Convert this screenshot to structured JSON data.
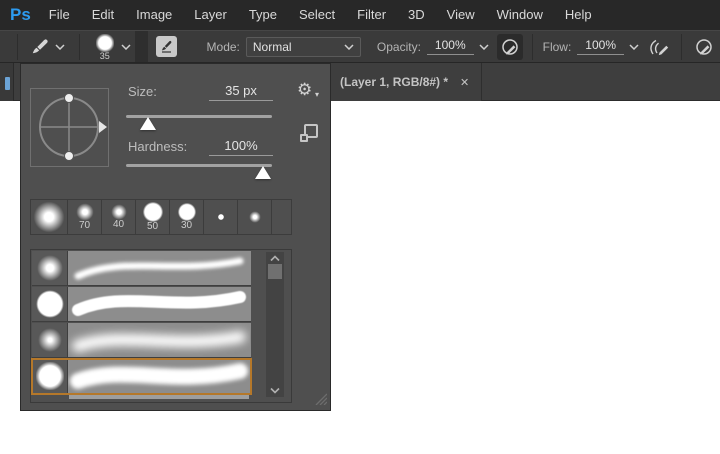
{
  "menu": {
    "logo": "Ps",
    "items": [
      "File",
      "Edit",
      "Image",
      "Layer",
      "Type",
      "Select",
      "Filter",
      "3D",
      "View",
      "Window",
      "Help"
    ]
  },
  "options_bar": {
    "brush_size_label": "35",
    "mode_label": "Mode:",
    "mode_value": "Normal",
    "opacity_label": "Opacity:",
    "opacity_value": "100%",
    "flow_label": "Flow:",
    "flow_value": "100%"
  },
  "tab_bar": {
    "document_title": "(Layer 1, RGB/8#) *",
    "close_glyph": "✕"
  },
  "brush_panel": {
    "size_label": "Size:",
    "size_value": "35 px",
    "size_slider_percent": 15,
    "hardness_label": "Hardness:",
    "hardness_value": "100%",
    "hardness_slider_percent": 100,
    "preset_labels": [
      "",
      "70",
      "40",
      "50",
      "30",
      "",
      ""
    ],
    "selected_stroke_index": 3,
    "stroke_row_count": 4
  },
  "icons": {
    "gear_glyph": "⚙",
    "caret_glyph": "▾"
  },
  "colors": {
    "accent_blue": "#2d9bf0",
    "selection_orange": "#b5782a",
    "panel_bg": "#4f4f4f",
    "menu_bg": "#282828",
    "options_bg": "#3a3a3a",
    "tab_bg": "#3e3e3e",
    "stroke_area_bg": "#8d8d8d"
  }
}
